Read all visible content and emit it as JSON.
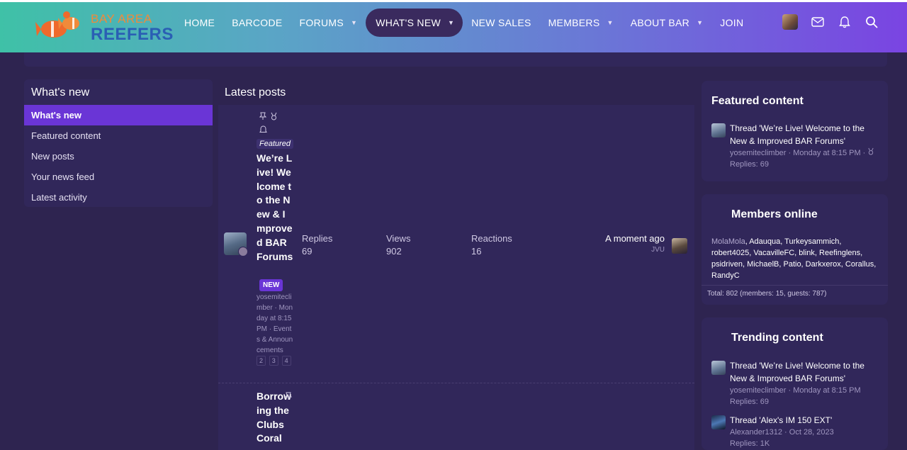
{
  "brand": {
    "line1": "BAY AREA",
    "line2": "REEFERS",
    "colors": {
      "orange": "#f08a3a",
      "blue": "#2a5fb4",
      "accent": "#6a35d6"
    }
  },
  "nav": {
    "items": [
      {
        "label": "HOME",
        "caret": false
      },
      {
        "label": "BARCODE",
        "caret": false
      },
      {
        "label": "FORUMS",
        "caret": true
      },
      {
        "label": "WHAT'S NEW",
        "caret": true,
        "active": true
      },
      {
        "label": "NEW SALES",
        "caret": false
      },
      {
        "label": "MEMBERS",
        "caret": true
      },
      {
        "label": "ABOUT BAR",
        "caret": true
      },
      {
        "label": "JOIN",
        "caret": false
      }
    ],
    "right_icons": [
      "user-avatar",
      "inbox-icon",
      "bell-icon",
      "search-icon"
    ]
  },
  "sidebar": {
    "title": "What's new",
    "items": [
      {
        "label": "What's new",
        "active": true
      },
      {
        "label": "Featured content"
      },
      {
        "label": "New posts"
      },
      {
        "label": "Your news feed"
      },
      {
        "label": "Latest activity"
      }
    ]
  },
  "main": {
    "title": "Latest posts",
    "threads": [
      {
        "featured_label": "Featured",
        "title": "We’re Live! Welcome to the New & Improved BAR Forums",
        "new_badge": "NEW",
        "meta": "yosemiteclimber · Monday at 8:15 PM · Events & Announcements",
        "pages": [
          "2",
          "3",
          "4"
        ],
        "replies_label": "Replies",
        "replies": "69",
        "views_label": "Views",
        "views": "902",
        "reactions_label": "Reactions",
        "reactions": "16",
        "last_time": "A moment ago",
        "last_user": "JVU"
      },
      {
        "title": "Borrowing the Clubs Coral"
      }
    ]
  },
  "featured": {
    "title": "Featured content",
    "item": {
      "text": "Thread 'We’re Live! Welcome to the New & Improved BAR Forums'",
      "meta": "yosemiteclimber · Monday at 8:15 PM ·",
      "replies": "Replies: 69"
    }
  },
  "members_online": {
    "title": "Members online",
    "first": "MolaMola",
    "rest": ", Adauqua, Turkeysammich, robert4025, VacavilleFC, blink, Reefinglens, psidriven, MichaelB, Patio, Darkxerox, Corallus, RandyC",
    "total": "Total: 802 (members: 15, guests: 787)"
  },
  "trending": {
    "title": "Trending content",
    "items": [
      {
        "text": "Thread 'We’re Live! Welcome to the New & Improved BAR Forums'",
        "meta": "yosemiteclimber · Monday at 8:15 PM",
        "replies": "Replies: 69"
      },
      {
        "text": "Thread 'Alex's IM 150 EXT'",
        "meta": "Alexander1312 · Oct 28, 2023",
        "replies": "Replies: 1K"
      }
    ]
  }
}
